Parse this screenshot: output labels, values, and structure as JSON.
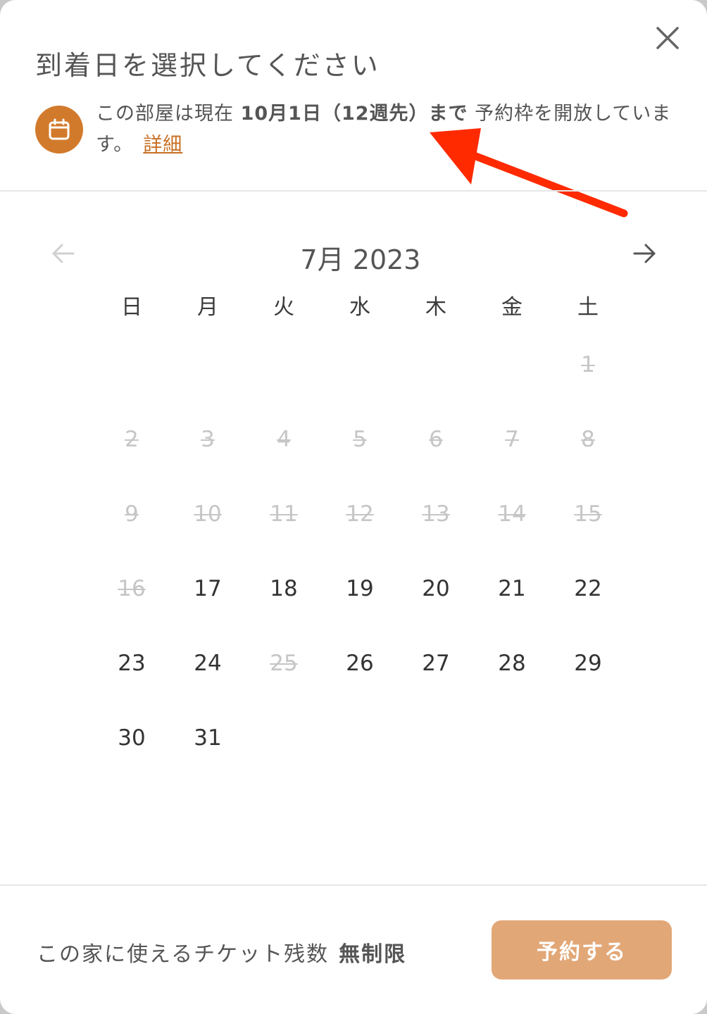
{
  "modal": {
    "title": "到着日を選択してください",
    "close_icon": "close-icon"
  },
  "notice": {
    "icon": "calendar-icon",
    "text_before": "この部屋は現在 ",
    "text_bold": "10月1日（12週先）まで",
    "text_after": " 予約枠を開放しています。",
    "link_label": "詳細"
  },
  "calendar": {
    "month_label": "7月 2023",
    "prev_icon": "arrow-left-icon",
    "next_icon": "arrow-right-icon",
    "weekdays": [
      "日",
      "月",
      "火",
      "水",
      "木",
      "金",
      "土"
    ],
    "leading_blanks": 6,
    "days": [
      {
        "label": "1",
        "available": false
      },
      {
        "label": "2",
        "available": false
      },
      {
        "label": "3",
        "available": false
      },
      {
        "label": "4",
        "available": false
      },
      {
        "label": "5",
        "available": false
      },
      {
        "label": "6",
        "available": false
      },
      {
        "label": "7",
        "available": false
      },
      {
        "label": "8",
        "available": false
      },
      {
        "label": "9",
        "available": false
      },
      {
        "label": "10",
        "available": false
      },
      {
        "label": "11",
        "available": false
      },
      {
        "label": "12",
        "available": false
      },
      {
        "label": "13",
        "available": false
      },
      {
        "label": "14",
        "available": false
      },
      {
        "label": "15",
        "available": false
      },
      {
        "label": "16",
        "available": false
      },
      {
        "label": "17",
        "available": true
      },
      {
        "label": "18",
        "available": true
      },
      {
        "label": "19",
        "available": true
      },
      {
        "label": "20",
        "available": true
      },
      {
        "label": "21",
        "available": true
      },
      {
        "label": "22",
        "available": true
      },
      {
        "label": "23",
        "available": true
      },
      {
        "label": "24",
        "available": true
      },
      {
        "label": "25",
        "available": false
      },
      {
        "label": "26",
        "available": true
      },
      {
        "label": "27",
        "available": true
      },
      {
        "label": "28",
        "available": true
      },
      {
        "label": "29",
        "available": true
      },
      {
        "label": "30",
        "available": true
      },
      {
        "label": "31",
        "available": true
      }
    ]
  },
  "footer": {
    "tickets_label": "この家に使えるチケット残数",
    "tickets_value": "無制限",
    "reserve_label": "予約する"
  },
  "colors": {
    "accent": "#d27a2c",
    "link": "#c96f22",
    "button": "#e2a777",
    "annotation_arrow": "#ff2a00",
    "disabled_day": "#c6c6c6"
  }
}
